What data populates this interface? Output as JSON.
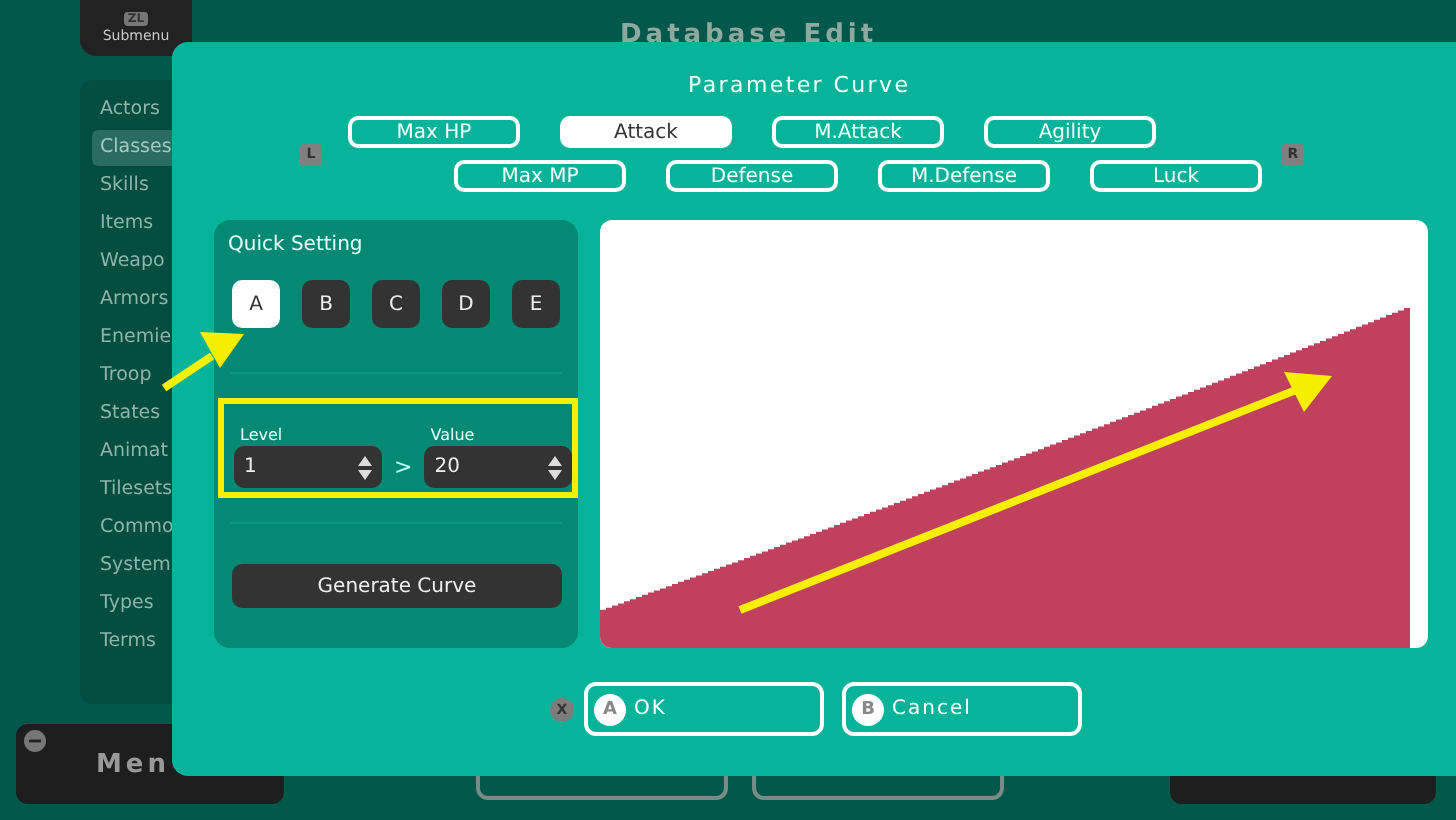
{
  "background": {
    "submenu": {
      "key": "ZL",
      "label": "Submenu"
    },
    "title": "Database Edit",
    "sidebar": {
      "items": [
        {
          "label": "Actors",
          "selected": false
        },
        {
          "label": "Classes",
          "selected": true
        },
        {
          "label": "Skills",
          "selected": false
        },
        {
          "label": "Items",
          "selected": false
        },
        {
          "label": "Weapo",
          "selected": false
        },
        {
          "label": "Armors",
          "selected": false
        },
        {
          "label": "Enemie",
          "selected": false
        },
        {
          "label": "Troop",
          "selected": false
        },
        {
          "label": "States",
          "selected": false
        },
        {
          "label": "Animat",
          "selected": false
        },
        {
          "label": "Tilesets",
          "selected": false
        },
        {
          "label": "Commo",
          "selected": false
        },
        {
          "label": "System",
          "selected": false
        },
        {
          "label": "Types",
          "selected": false
        },
        {
          "label": "Terms",
          "selected": false
        }
      ]
    },
    "menu_button": "Men"
  },
  "dialog": {
    "title": "Parameter Curve",
    "left_key": "L",
    "right_key": "R",
    "tab_rows": [
      [
        {
          "label": "Max HP",
          "selected": false
        },
        {
          "label": "Attack",
          "selected": true
        },
        {
          "label": "M.Attack",
          "selected": false
        },
        {
          "label": "Agility",
          "selected": false
        }
      ],
      [
        {
          "label": "Max MP",
          "selected": false
        },
        {
          "label": "Defense",
          "selected": false
        },
        {
          "label": "M.Defense",
          "selected": false
        },
        {
          "label": "Luck",
          "selected": false
        }
      ]
    ],
    "quick_setting": {
      "title": "Quick Setting",
      "presets": [
        {
          "label": "A",
          "selected": true
        },
        {
          "label": "B",
          "selected": false
        },
        {
          "label": "C",
          "selected": false
        },
        {
          "label": "D",
          "selected": false
        },
        {
          "label": "E",
          "selected": false
        }
      ],
      "range": {
        "highlighted": true,
        "level": {
          "label": "Level",
          "value": "1"
        },
        "separator": ">",
        "value": {
          "label": "Value",
          "value": "20"
        }
      },
      "generate_button": "Generate Curve"
    },
    "close_key": "X",
    "buttons": [
      {
        "key": "A",
        "label": "OK"
      },
      {
        "key": "B",
        "label": "Cancel"
      }
    ]
  }
}
